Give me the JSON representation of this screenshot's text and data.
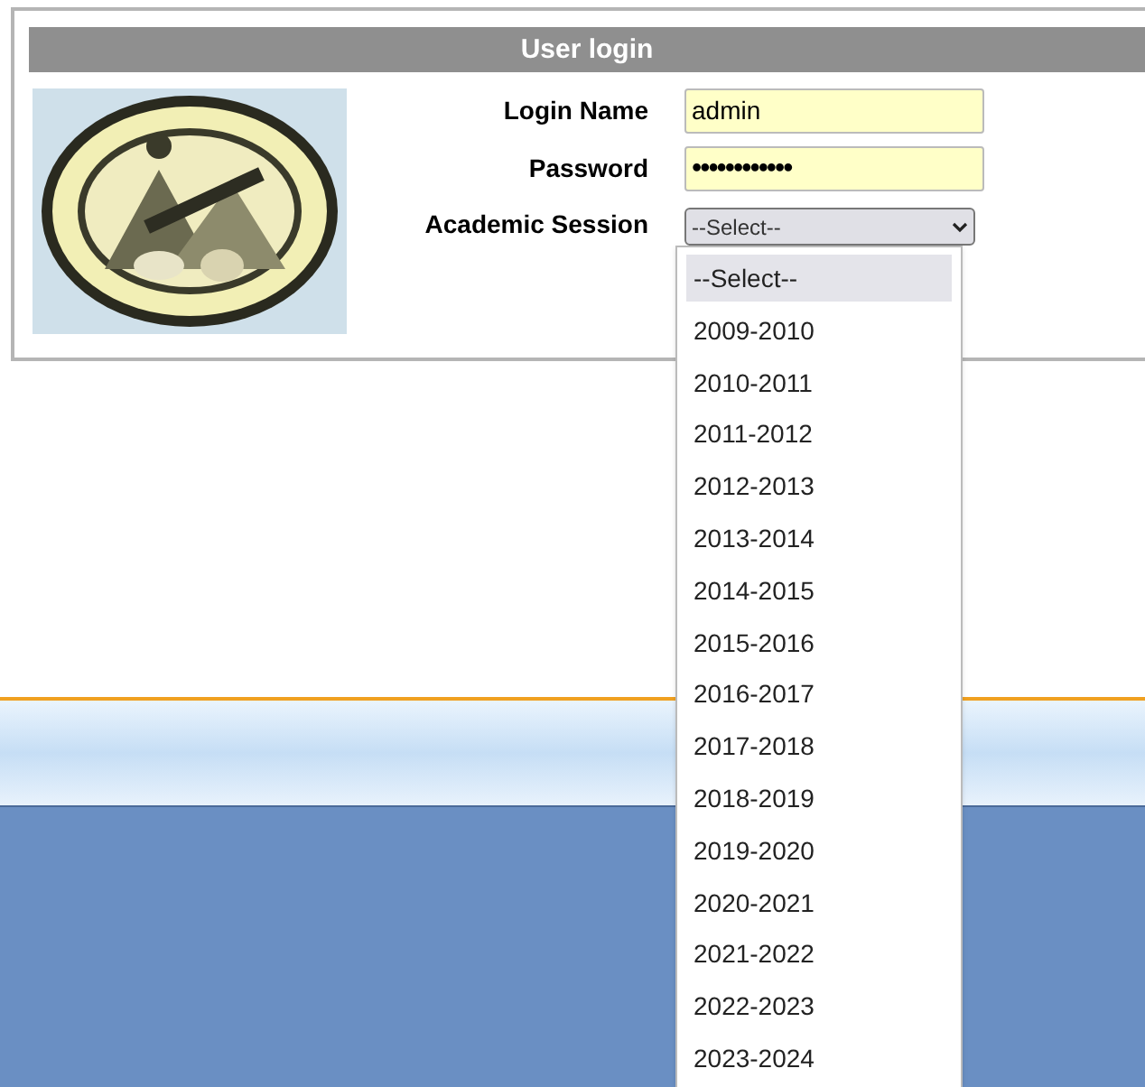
{
  "login_panel": {
    "title": "User login",
    "fields": [
      {
        "kind": "text",
        "label": "Login Name",
        "value": "admin"
      },
      {
        "kind": "password",
        "label": "Password",
        "value": "••••••••••••"
      },
      {
        "kind": "select",
        "label": "Academic Session",
        "value": "--Select--",
        "expanded": true
      }
    ]
  },
  "session_options": [
    {
      "label": "--Select--",
      "selected": true
    },
    {
      "label": "2009-2010",
      "selected": false
    },
    {
      "label": "2010-2011",
      "selected": false
    },
    {
      "label": "2011-2012",
      "selected": false
    },
    {
      "label": "2012-2013",
      "selected": false
    },
    {
      "label": "2013-2014",
      "selected": false
    },
    {
      "label": "2014-2015",
      "selected": false
    },
    {
      "label": "2015-2016",
      "selected": false
    },
    {
      "label": "2016-2017",
      "selected": false
    },
    {
      "label": "2017-2018",
      "selected": false
    },
    {
      "label": "2018-2019",
      "selected": false
    },
    {
      "label": "2019-2020",
      "selected": false
    },
    {
      "label": "2020-2021",
      "selected": false
    },
    {
      "label": "2021-2022",
      "selected": false
    },
    {
      "label": "2022-2023",
      "selected": false
    },
    {
      "label": "2023-2024",
      "selected": false
    }
  ]
}
